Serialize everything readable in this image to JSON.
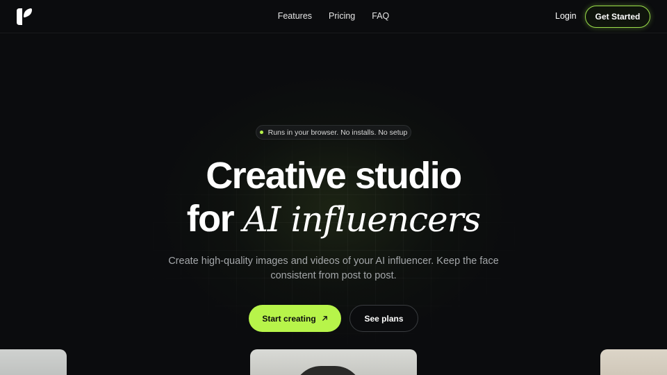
{
  "nav": {
    "links": [
      "Features",
      "Pricing",
      "FAQ"
    ],
    "login_label": "Login",
    "cta_label": "Get Started"
  },
  "hero": {
    "badge": "Runs in your browser. No installs. No setup",
    "title_line1": "Creative studio",
    "title_line2_plain": "for",
    "title_line2_italic": "AI influencers",
    "subtitle": "Create high-quality images and videos of your AI influencer. Keep the face consistent from post to post.",
    "primary_button": "Start creating",
    "primary_icon": "arrow-up-right-icon",
    "secondary_button": "See plans"
  },
  "colors": {
    "background": "#0b0c0e",
    "accent": "#b7f44a",
    "muted_text": "#a4a7aa"
  }
}
